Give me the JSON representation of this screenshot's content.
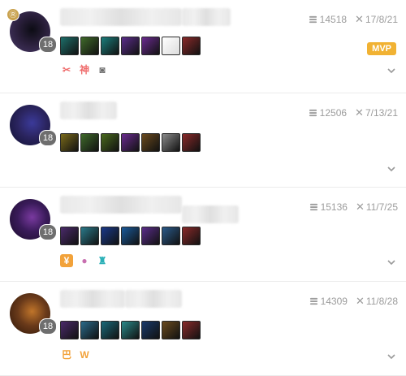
{
  "matches": [
    {
      "level": "18",
      "gold": "14518",
      "date": "17/8/21",
      "mvp": true,
      "mvp_label": "MVP",
      "has_crown": true,
      "crown_glyph": "Ⓡ",
      "avatar_colors": [
        "#2a1f3b",
        "#0c0c14",
        "#4a3a6a"
      ],
      "item_colors": [
        "#1d6f6a",
        "#3f6a2a",
        "#1b7e7c",
        "#5a2d8a",
        "#6a2b8f",
        "#e9e9e9",
        "#8a2a2a"
      ],
      "badges": [
        {
          "icon": "skull-icon",
          "glyph": "✂",
          "color": "#ef6b6b"
        },
        {
          "icon": "god-icon",
          "glyph": "神",
          "color": "#ef6b6b"
        },
        {
          "icon": "ward-icon",
          "glyph": "◙",
          "color": "#6e6e6e"
        }
      ]
    },
    {
      "level": "18",
      "gold": "12506",
      "date": "7/13/21",
      "mvp": false,
      "avatar_colors": [
        "#2b2560",
        "#3b3a9a",
        "#101030"
      ],
      "item_colors": [
        "#7a6a1a",
        "#3f6a2a",
        "#4a6a1e",
        "#6a2b8f",
        "#6a4a1e",
        "#8a8a8a",
        "#8a2a2a"
      ],
      "badges": []
    },
    {
      "level": "18",
      "gold": "15136",
      "date": "11/7/25",
      "mvp": false,
      "avatar_colors": [
        "#3a1b5a",
        "#7a3aa0",
        "#1a0c28"
      ],
      "item_colors": [
        "#4a2a6a",
        "#2a7a8a",
        "#1a3a8a",
        "#1a5a9a",
        "#5a2d8a",
        "#2a5a8a",
        "#8a2a2a"
      ],
      "badges": [
        {
          "icon": "gold-coin-icon",
          "glyph": "¥",
          "color": "#f2a23a",
          "bg": true
        },
        {
          "icon": "alien-icon",
          "glyph": "●",
          "color": "#c86fb0"
        },
        {
          "icon": "tower-icon",
          "glyph": "♜",
          "color": "#2bb0b7"
        }
      ]
    },
    {
      "level": "18",
      "gold": "14309",
      "date": "11/8/28",
      "mvp": false,
      "avatar_colors": [
        "#6a3a1a",
        "#c0752a",
        "#2a1408"
      ],
      "item_colors": [
        "#4a2a6a",
        "#2a6a8a",
        "#1a6a7a",
        "#2a8a8a",
        "#1a3a6a",
        "#6a4a1e",
        "#8a2a2a"
      ],
      "badges": [
        {
          "icon": "triple-kill-icon",
          "glyph": "巴",
          "color": "#f2a23a"
        },
        {
          "icon": "crown-icon",
          "glyph": "W",
          "color": "#f2a23a"
        }
      ]
    }
  ]
}
